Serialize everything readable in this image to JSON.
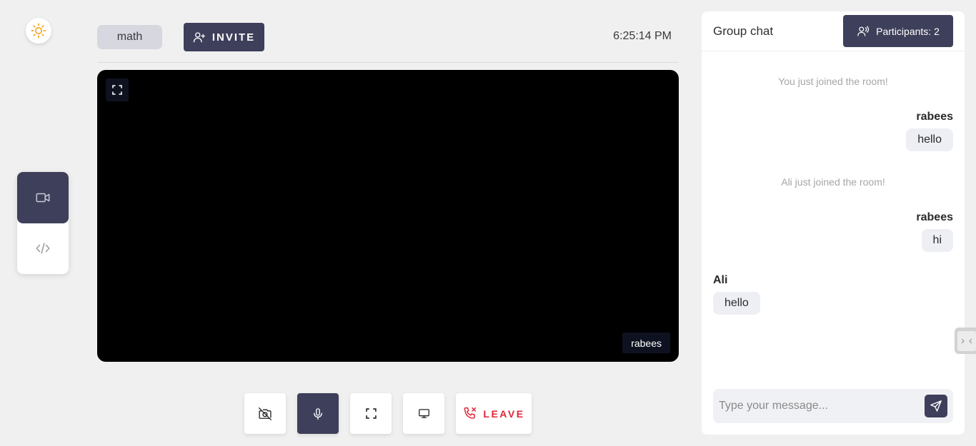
{
  "room": {
    "name": "math"
  },
  "header": {
    "invite_label": "INVITE",
    "time": "6:25:14 PM"
  },
  "video": {
    "participant_name": "rabees"
  },
  "controls": {
    "leave_label": "LEAVE"
  },
  "chat": {
    "title": "Group chat",
    "participants_label": "Participants: 2",
    "messages": [
      {
        "type": "system",
        "text": "You just joined the room!"
      },
      {
        "type": "message",
        "sender": "rabees",
        "text": "hello",
        "side": "right"
      },
      {
        "type": "system",
        "text": "Ali just joined the room!"
      },
      {
        "type": "message",
        "sender": "rabees",
        "text": "hi",
        "side": "right"
      },
      {
        "type": "message",
        "sender": "Ali",
        "text": "hello",
        "side": "left"
      }
    ],
    "input_placeholder": "Type your message..."
  },
  "colors": {
    "primary_dark": "#3e3f5a",
    "leave_red": "#e02535",
    "sun_orange": "#f5a524",
    "video_bg": "#000000"
  },
  "icons": [
    "sun-icon",
    "video-camera-icon",
    "code-icon",
    "user-plus-icon",
    "expand-icon",
    "camera-off-icon",
    "microphone-icon",
    "fullscreen-icon",
    "monitor-icon",
    "phone-x-icon",
    "users-icon",
    "send-icon"
  ]
}
